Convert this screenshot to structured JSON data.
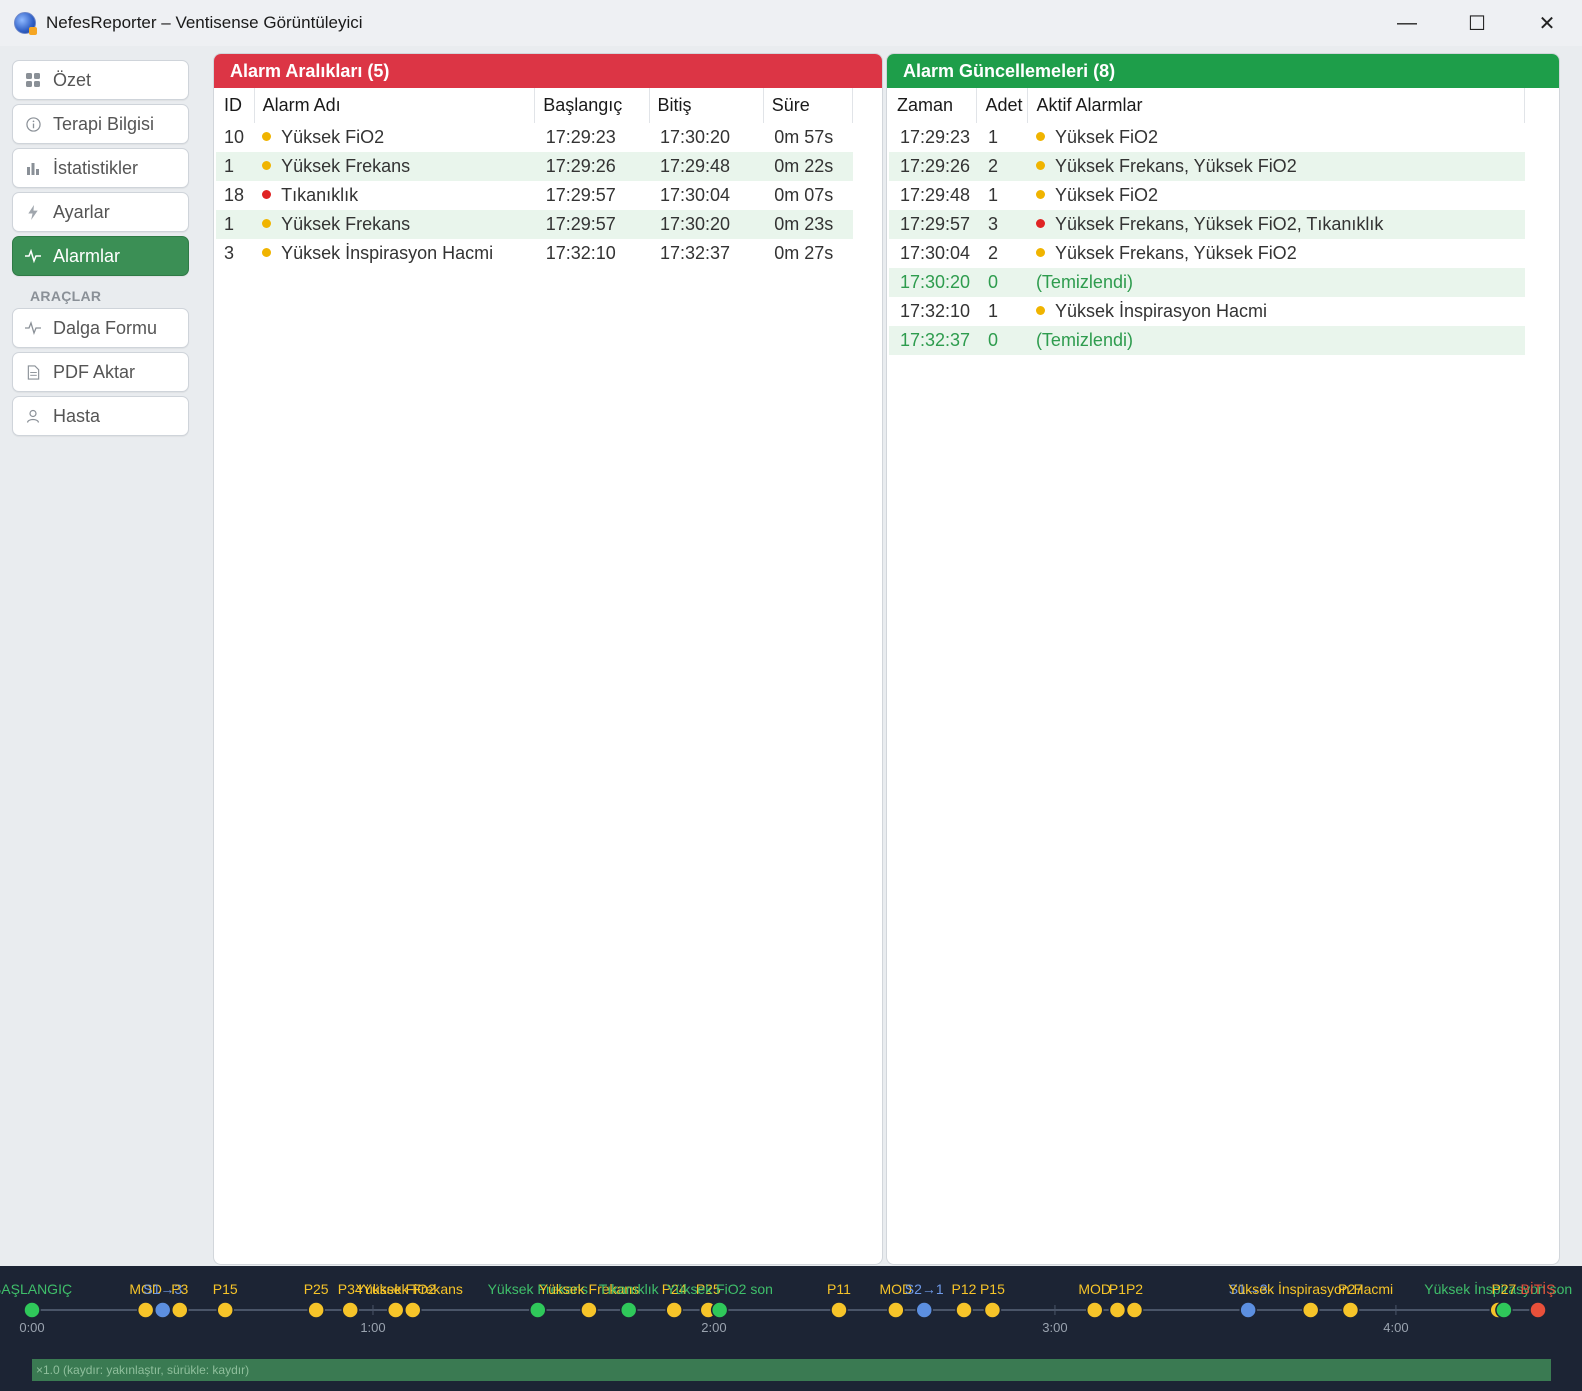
{
  "window": {
    "title": "NefesReporter – Ventisense Görüntüleyici",
    "minimize": "—",
    "maximize": "☐",
    "close": "✕"
  },
  "sidebar": {
    "items": [
      {
        "label": "Özet",
        "icon": "grid-icon"
      },
      {
        "label": "Terapi Bilgisi",
        "icon": "info-icon"
      },
      {
        "label": "İstatistikler",
        "icon": "bar-chart-icon"
      },
      {
        "label": "Ayarlar",
        "icon": "bolt-icon"
      },
      {
        "label": "Alarmlar",
        "icon": "pulse-icon",
        "active": true
      }
    ],
    "section_label": "ARAÇLAR",
    "tools": [
      {
        "label": "Dalga Formu",
        "icon": "waveform-icon"
      },
      {
        "label": "PDF Aktar",
        "icon": "document-icon"
      },
      {
        "label": "Hasta",
        "icon": "user-icon"
      }
    ]
  },
  "alarm_intervals": {
    "title": "Alarm Aralıkları (5)",
    "columns": [
      "ID",
      "Alarm Adı",
      "Başlangıç",
      "Bitiş",
      "Süre"
    ],
    "rows": [
      {
        "id": "10",
        "name": "Yüksek FiO2",
        "severity": "#f0b400",
        "start": "17:29:23",
        "end": "17:30:20",
        "duration": "0m 57s"
      },
      {
        "id": "1",
        "name": "Yüksek Frekans",
        "severity": "#f0b400",
        "start": "17:29:26",
        "end": "17:29:48",
        "duration": "0m 22s"
      },
      {
        "id": "18",
        "name": "Tıkanıklık",
        "severity": "#e02424",
        "start": "17:29:57",
        "end": "17:30:04",
        "duration": "0m 07s"
      },
      {
        "id": "1",
        "name": "Yüksek Frekans",
        "severity": "#f0b400",
        "start": "17:29:57",
        "end": "17:30:20",
        "duration": "0m 23s"
      },
      {
        "id": "3",
        "name": "Yüksek İnspirasyon Hacmi",
        "severity": "#f0b400",
        "start": "17:32:10",
        "end": "17:32:37",
        "duration": "0m 27s"
      }
    ]
  },
  "alarm_updates": {
    "title": "Alarm Güncellemeleri (8)",
    "columns": [
      "Zaman",
      "Adet",
      "Aktif Alarmlar"
    ],
    "rows": [
      {
        "time": "17:29:23",
        "count": "1",
        "alarms": "Yüksek FiO2",
        "severity": "#f0b400"
      },
      {
        "time": "17:29:26",
        "count": "2",
        "alarms": "Yüksek Frekans, Yüksek FiO2",
        "severity": "#f0b400"
      },
      {
        "time": "17:29:48",
        "count": "1",
        "alarms": "Yüksek FiO2",
        "severity": "#f0b400"
      },
      {
        "time": "17:29:57",
        "count": "3",
        "alarms": "Yüksek Frekans, Yüksek FiO2, Tıkanıklık",
        "severity": "#e02424"
      },
      {
        "time": "17:30:04",
        "count": "2",
        "alarms": "Yüksek Frekans, Yüksek FiO2",
        "severity": "#f0b400"
      },
      {
        "time": "17:30:20",
        "count": "0",
        "alarms": "(Temizlendi)",
        "cleared": true
      },
      {
        "time": "17:32:10",
        "count": "1",
        "alarms": "Yüksek İnspirasyon Hacmi",
        "severity": "#f0b400"
      },
      {
        "time": "17:32:37",
        "count": "0",
        "alarms": "(Temizlendi)",
        "cleared": true
      }
    ]
  },
  "timeline": {
    "ticks": [
      "0:00",
      "1:00",
      "2:00",
      "3:00",
      "4:00"
    ],
    "tick_seconds": [
      0,
      60,
      120,
      180,
      240
    ],
    "duration_seconds": 265,
    "colors": {
      "green": "#2fc85a",
      "yellow": "#f6c429",
      "blue": "#5c8fe0",
      "red": "#e8503a"
    },
    "markers": [
      {
        "t": 0,
        "color": "green",
        "label": "BAŞLANGIÇ",
        "label_color": "#3fbf6a"
      },
      {
        "t": 20,
        "color": "yellow",
        "label": "MOD",
        "label_color": "#f6c429"
      },
      {
        "t": 23,
        "color": "blue",
        "label": "S1→3",
        "label_color": "#6f9ae8"
      },
      {
        "t": 26,
        "color": "yellow",
        "label": "P3",
        "label_color": "#f6c429"
      },
      {
        "t": 34,
        "color": "yellow",
        "label": "P15",
        "label_color": "#f6c429"
      },
      {
        "t": 50,
        "color": "yellow",
        "label": "P25",
        "label_color": "#f6c429"
      },
      {
        "t": 56,
        "color": "yellow",
        "label": "P34",
        "label_color": "#f6c429"
      },
      {
        "t": 64,
        "color": "yellow",
        "label": "Yüksek FiO2",
        "label_color": "#f6c429"
      },
      {
        "t": 67,
        "color": "yellow",
        "label": "Yüksek Frekans",
        "label_color": "#f6c429"
      },
      {
        "t": 89,
        "color": "green",
        "label": "Yüksek Frekans",
        "label_color": "#3fbf6a"
      },
      {
        "t": 98,
        "color": "yellow",
        "label": "Yüksek Frekans",
        "label_color": "#f6c429"
      },
      {
        "t": 105,
        "color": "green",
        "label": "Tıkanıklık",
        "label_color": "#3fbf6a"
      },
      {
        "t": 113,
        "color": "yellow",
        "label": "P24",
        "label_color": "#f6c429"
      },
      {
        "t": 119,
        "color": "yellow",
        "label": "P25",
        "label_color": "#f6c429"
      },
      {
        "t": 121,
        "color": "green",
        "label": "Yüksek FiO2 son",
        "label_color": "#3fbf6a"
      },
      {
        "t": 142,
        "color": "yellow",
        "label": "P11",
        "label_color": "#f6c429"
      },
      {
        "t": 152,
        "color": "yellow",
        "label": "MOD",
        "label_color": "#f6c429"
      },
      {
        "t": 157,
        "color": "blue",
        "label": "S2→1",
        "label_color": "#6f9ae8"
      },
      {
        "t": 164,
        "color": "yellow",
        "label": "P12",
        "label_color": "#f6c429"
      },
      {
        "t": 169,
        "color": "yellow",
        "label": "P15",
        "label_color": "#f6c429"
      },
      {
        "t": 187,
        "color": "yellow",
        "label": "MOD",
        "label_color": "#f6c429"
      },
      {
        "t": 191,
        "color": "yellow",
        "label": "P1",
        "label_color": "#f6c429"
      },
      {
        "t": 194,
        "color": "yellow",
        "label": "P2",
        "label_color": "#f6c429"
      },
      {
        "t": 214,
        "color": "blue",
        "label": "S1→3",
        "label_color": "#6f9ae8"
      },
      {
        "t": 225,
        "color": "yellow",
        "label": "Yüksek İnspirasyon Hacmi",
        "label_color": "#f6c429"
      },
      {
        "t": 232,
        "color": "yellow",
        "label": "P27",
        "label_color": "#f6c429"
      },
      {
        "t": 258,
        "color": "yellow",
        "label": "Yüksek İnspirasyon son",
        "label_color": "#3fbf6a"
      },
      {
        "t": 259,
        "color": "green",
        "label": "P27",
        "label_color": "#f6c429"
      },
      {
        "t": 265,
        "color": "red",
        "label": "BİTİŞ",
        "label_color": "#e8503a"
      }
    ],
    "zoom_text": "×1.0  (kaydır: yakınlaştır, sürükle: kaydır)"
  }
}
